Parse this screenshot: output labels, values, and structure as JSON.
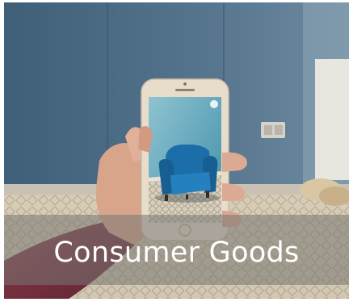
{
  "caption": {
    "text": "Consumer Goods"
  },
  "colors": {
    "wall": "#4c6a82",
    "chair": "#1c6ea8",
    "phone_body": "#e8dccb",
    "caption_text": "#ffffff"
  }
}
